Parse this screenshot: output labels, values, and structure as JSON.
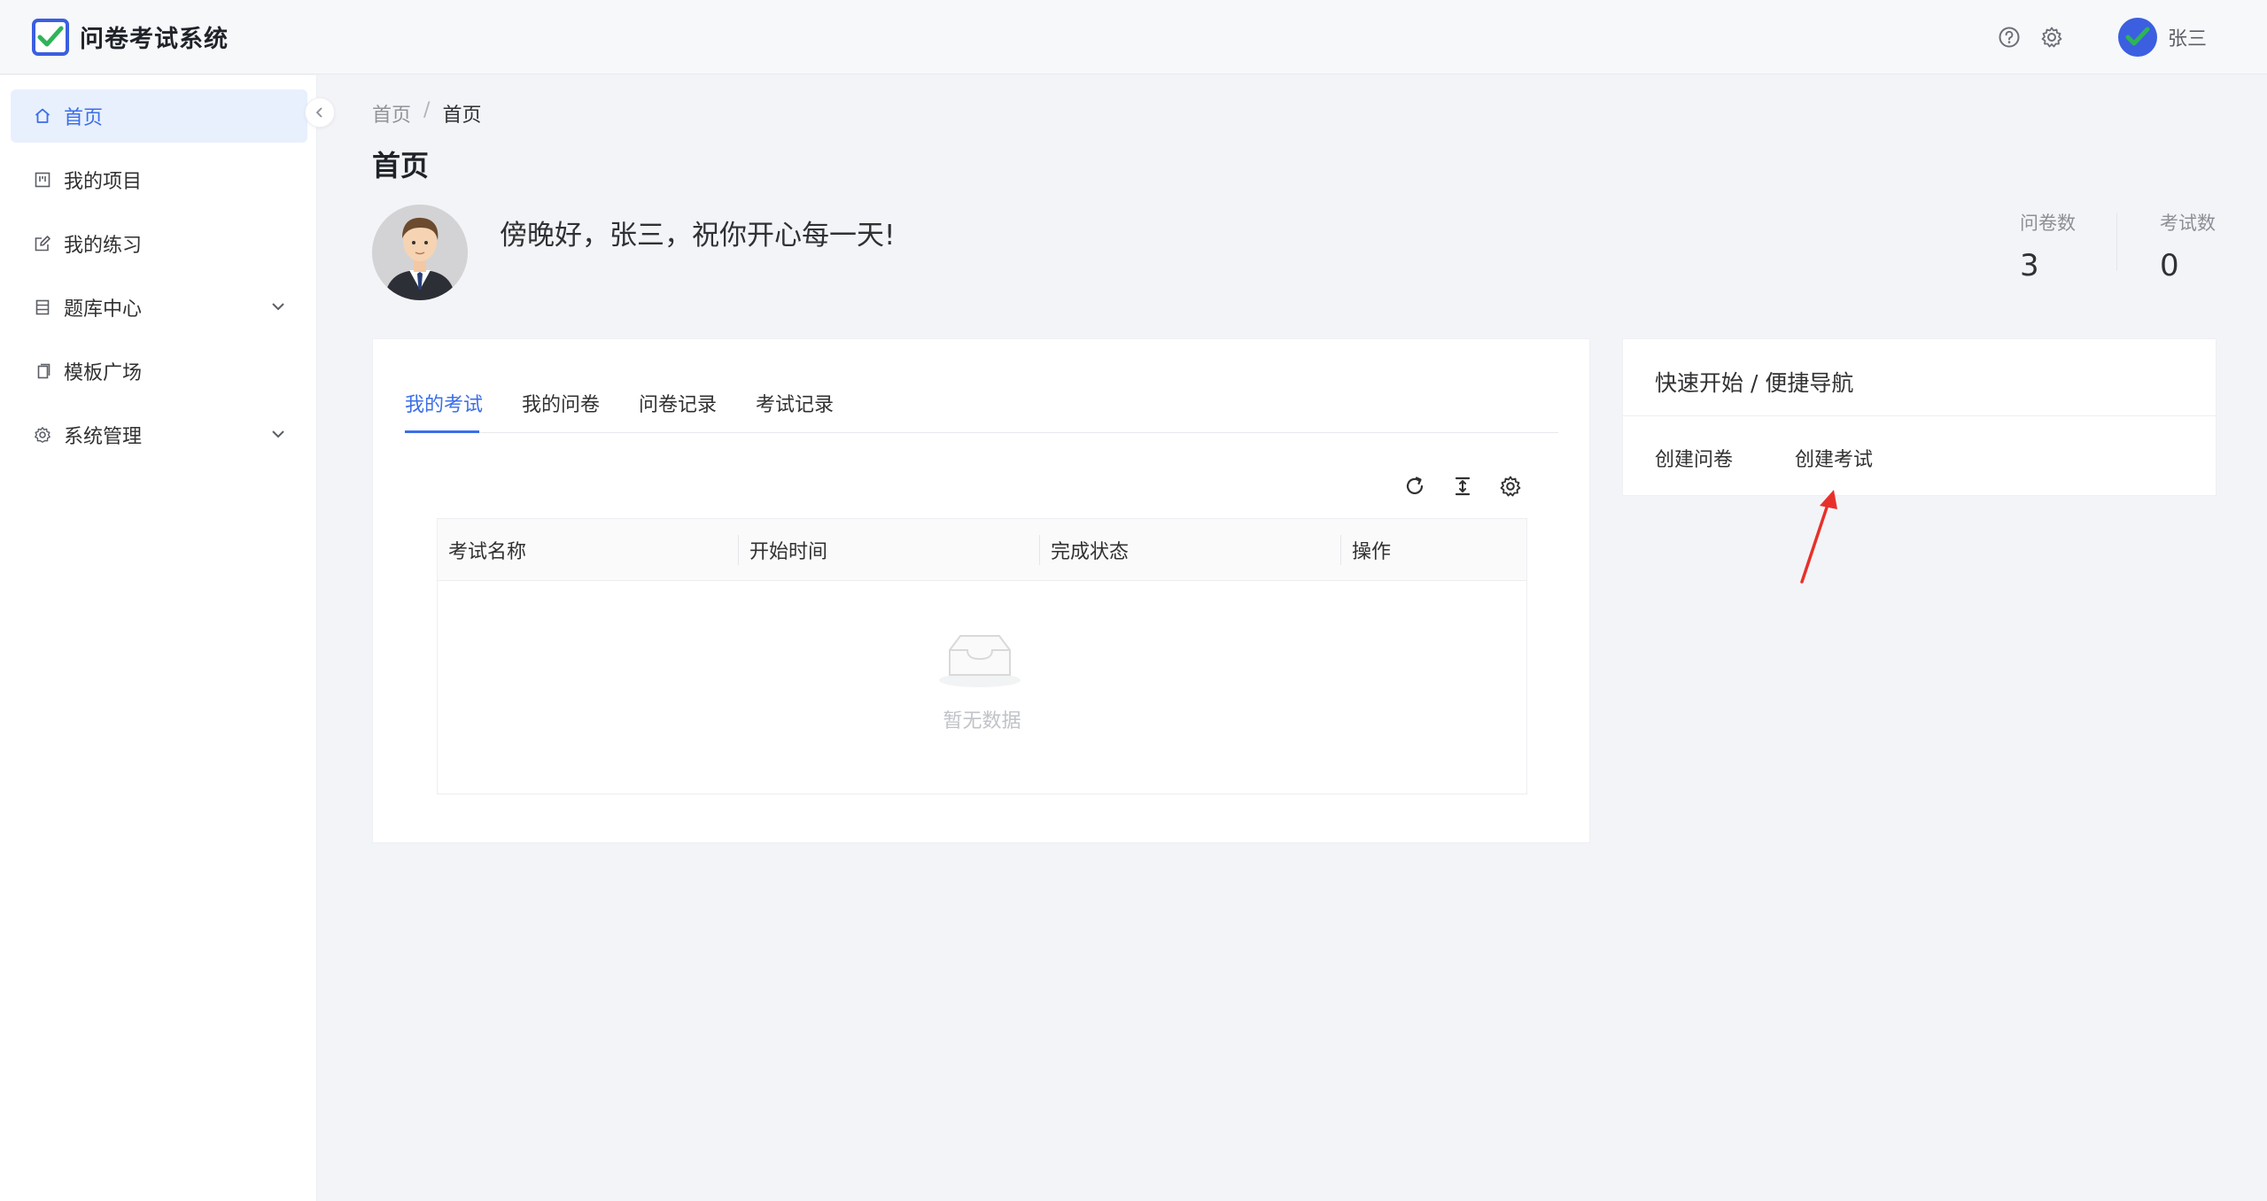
{
  "app": {
    "title": "问卷考试系统"
  },
  "header": {
    "user_name": "张三"
  },
  "sidebar": {
    "items": [
      {
        "label": "首页"
      },
      {
        "label": "我的项目"
      },
      {
        "label": "我的练习"
      },
      {
        "label": "题库中心"
      },
      {
        "label": "模板广场"
      },
      {
        "label": "系统管理"
      }
    ]
  },
  "breadcrumb": {
    "root": "首页",
    "separator": "/",
    "current": "首页"
  },
  "page": {
    "title": "首页"
  },
  "greeting": "傍晚好，张三，祝你开心每一天!",
  "stats": [
    {
      "label": "问卷数",
      "value": "3"
    },
    {
      "label": "考试数",
      "value": "0"
    }
  ],
  "tabs": [
    {
      "label": "我的考试"
    },
    {
      "label": "我的问卷"
    },
    {
      "label": "问卷记录"
    },
    {
      "label": "考试记录"
    }
  ],
  "table": {
    "columns": [
      "考试名称",
      "开始时间",
      "完成状态",
      "操作"
    ],
    "empty_text": "暂无数据"
  },
  "quick_start": {
    "title": "快速开始 / 便捷导航",
    "links": [
      {
        "label": "创建问卷"
      },
      {
        "label": "创建考试"
      }
    ]
  },
  "colors": {
    "accent": "#3b6ee8",
    "logo": "#3b5fe0",
    "active_bg": "#e8f0fd",
    "arrow": "#e8302a"
  }
}
